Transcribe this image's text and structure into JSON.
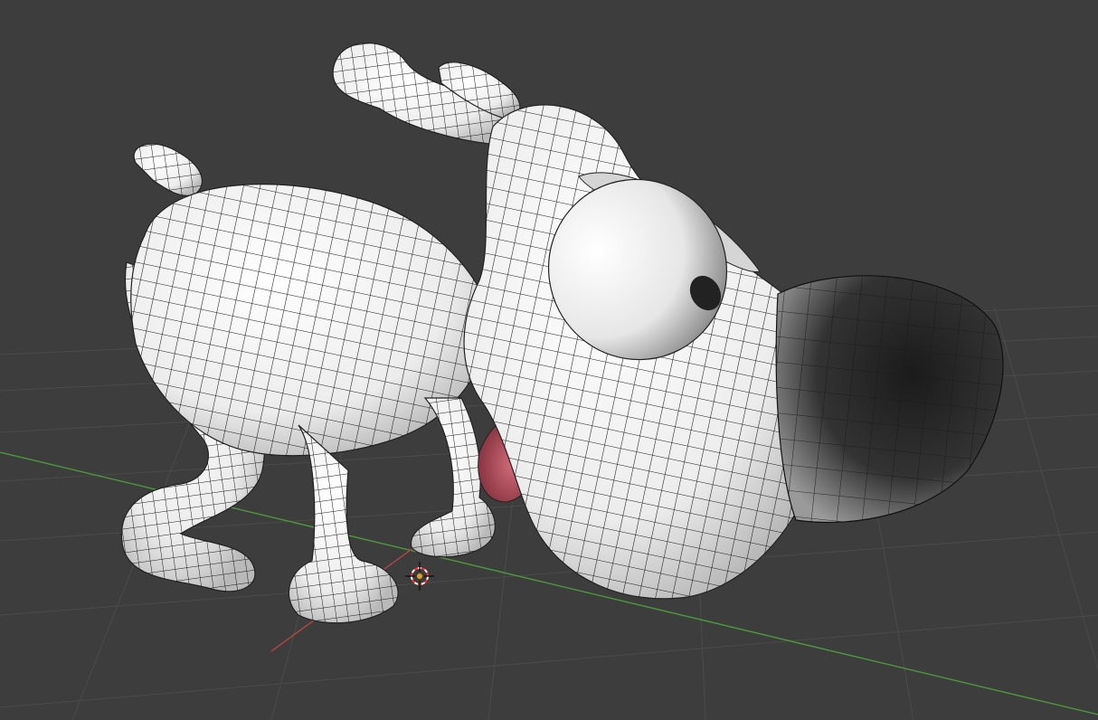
{
  "app": {
    "editor": "3D Viewport",
    "background_color": "#3d3d3d",
    "grid_color": "#4a4a4a",
    "x_axis_color": "#b04545",
    "y_axis_color": "#4a9a3a"
  },
  "scene": {
    "object": {
      "icon": "dog-mesh-icon",
      "shading": "solid",
      "overlay": "wireframe",
      "body_color": "#f4f4f4",
      "wire_color": "#1a1a1a",
      "nose_color": "#2a2a2a",
      "mouth_color": "#b24a5a"
    },
    "cursor_3d": {
      "icon": "3d-cursor-icon",
      "colors": [
        "#ff3030",
        "#ffffff"
      ]
    }
  }
}
